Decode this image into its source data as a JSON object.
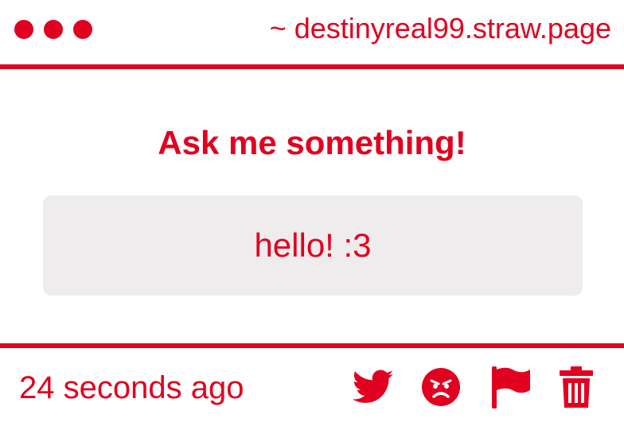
{
  "window": {
    "url": "~ destinyreal99.straw.page"
  },
  "main": {
    "title": "Ask me something!",
    "message": "hello! :3"
  },
  "footer": {
    "timestamp": "24 seconds ago",
    "actions": [
      {
        "icon": "twitter-icon"
      },
      {
        "icon": "angry-face-icon"
      },
      {
        "icon": "flag-icon"
      },
      {
        "icon": "trash-icon"
      }
    ]
  },
  "colors": {
    "accent": "#e1001f",
    "message_background": "#eeecec"
  }
}
